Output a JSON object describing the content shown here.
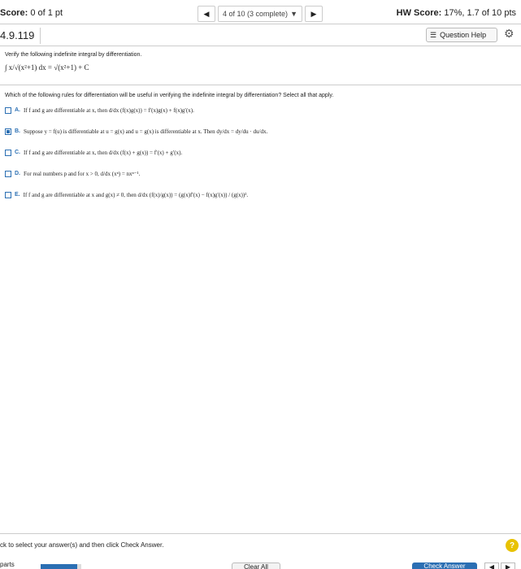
{
  "header": {
    "score_label": "Score:",
    "score_value": "0 of 1 pt",
    "nav_position": "4 of 10 (3 complete)",
    "hw_label": "HW Score:",
    "hw_value": "17%, 1.7 of 10 pts"
  },
  "problem": {
    "id": "4.9.119",
    "question_help": "Question Help"
  },
  "content": {
    "instruction": "Verify the following indefinite integral by differentiation.",
    "integral": "∫ x/√(x²+1) dx = √(x²+1) + C",
    "question": "Which of the following rules for differentiation will be useful in verifying the indefinite integral by differentiation? Select all that apply.",
    "options": [
      {
        "letter": "A.",
        "text": "If f and g are differentiable at x, then d/dx (f(x)g(x)) = f′(x)g(x) + f(x)g′(x).",
        "checked": false
      },
      {
        "letter": "B.",
        "text": "Suppose y = f(u) is differentiable at u = g(x) and u = g(x) is differentiable at x. Then dy/dx = dy/du · du/dx.",
        "checked": true
      },
      {
        "letter": "C.",
        "text": "If f and g are differentiable at x, then d/dx (f(x) + g(x)) = f′(x) + g′(x).",
        "checked": false
      },
      {
        "letter": "D.",
        "text": "For real numbers p and for x > 0, d/dx (xⁿ) = nxⁿ⁻¹.",
        "checked": false
      },
      {
        "letter": "E.",
        "text": "If f and g are differentiable at x and g(x) ≠ 0, then d/dx (f(x)/g(x)) = (g(x)f′(x) − f(x)g′(x)) / (g(x))².",
        "checked": false
      }
    ]
  },
  "footer": {
    "instruction": "ck to select your answer(s) and then click Check Answer.",
    "help": "?",
    "parts_label": "parts",
    "progress": 0.9,
    "clear_all": "Clear All",
    "check_answer": "Check Answer",
    "prev": "◀",
    "next": "▶"
  }
}
